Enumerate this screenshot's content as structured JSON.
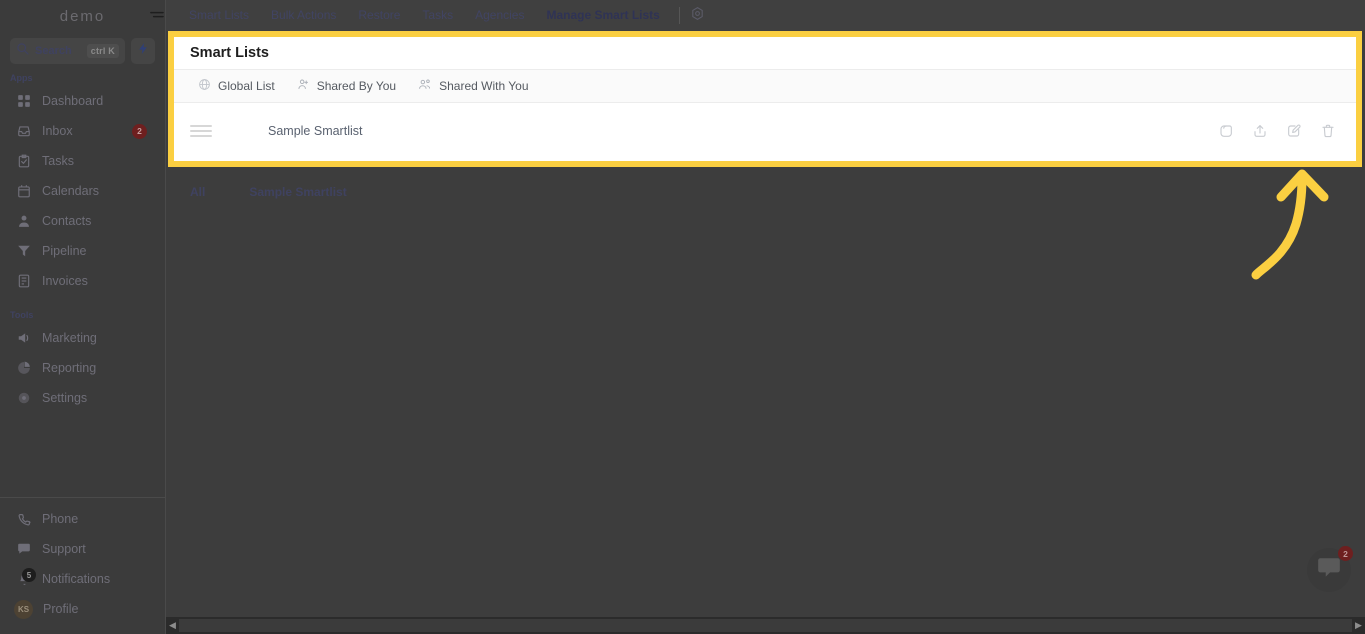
{
  "colors": {
    "highlight": "#FBCF41",
    "arrow": "#FBCF41",
    "panel_bg": "#ffffff",
    "app_bg": "#3d3d3d",
    "sidebar_bg": "#3b3b3b",
    "badge_red": "#6e1f1f",
    "nav_link": "#414463"
  },
  "sidebar": {
    "brand": "demo",
    "collapse_icon": "collapse-menu-icon",
    "search": {
      "label": "Search",
      "placeholder": "Search",
      "shortcut": "ctrl K"
    },
    "quick_action_icon": "lightning-bolt-icon",
    "sections": [
      {
        "label": "Apps",
        "items": [
          {
            "label": "Dashboard",
            "icon": "dashboard-grid-icon",
            "badge": ""
          },
          {
            "label": "Inbox",
            "icon": "inbox-icon",
            "badge": "2"
          },
          {
            "label": "Tasks",
            "icon": "tasks-clipboard-icon",
            "badge": ""
          },
          {
            "label": "Calendars",
            "icon": "calendar-icon",
            "badge": ""
          },
          {
            "label": "Contacts",
            "icon": "contacts-person-icon",
            "badge": ""
          },
          {
            "label": "Pipeline",
            "icon": "pipeline-funnel-icon",
            "badge": ""
          },
          {
            "label": "Invoices",
            "icon": "invoices-document-icon",
            "badge": ""
          }
        ]
      },
      {
        "label": "Tools",
        "items": [
          {
            "label": "Marketing",
            "icon": "megaphone-icon",
            "badge": ""
          },
          {
            "label": "Reporting",
            "icon": "pie-chart-icon",
            "badge": ""
          },
          {
            "label": "Settings",
            "icon": "gear-icon",
            "badge": ""
          }
        ]
      }
    ],
    "bottom_items": [
      {
        "label": "Phone",
        "icon": "phone-icon",
        "badge": ""
      },
      {
        "label": "Support",
        "icon": "support-chat-icon",
        "badge": ""
      },
      {
        "label": "Notifications",
        "icon": "bell-icon",
        "badge": "5"
      }
    ],
    "profile": {
      "label": "Profile",
      "initials": "KS"
    }
  },
  "topnav": {
    "items": [
      {
        "label": "Smart Lists",
        "active": false
      },
      {
        "label": "Bulk Actions",
        "active": false
      },
      {
        "label": "Restore",
        "active": false
      },
      {
        "label": "Tasks",
        "active": false
      },
      {
        "label": "Agencies",
        "active": false
      },
      {
        "label": "Manage Smart Lists",
        "active": true
      }
    ],
    "settings_icon": "gear-icon"
  },
  "panel": {
    "title": "Smart Lists",
    "filters": [
      {
        "label": "Global List",
        "icon": "globe-icon"
      },
      {
        "label": "Shared By You",
        "icon": "person-share-icon"
      },
      {
        "label": "Shared With You",
        "icon": "people-group-icon"
      }
    ],
    "rows": [
      {
        "name": "Sample Smartlist",
        "drag_handle": "drag-handle-icon",
        "actions": [
          {
            "name": "duplicate-icon",
            "glyph": "duplicate"
          },
          {
            "name": "share-upload-icon",
            "glyph": "upload"
          },
          {
            "name": "edit-icon",
            "glyph": "edit"
          },
          {
            "name": "delete-icon",
            "glyph": "trash"
          }
        ]
      }
    ]
  },
  "subtabs": [
    {
      "label": "All"
    },
    {
      "label": "Sample Smartlist"
    }
  ],
  "annotation": {
    "type": "curved-arrow-up",
    "points_to": "edit-icon",
    "color": "#FBCF41"
  },
  "chat_widget": {
    "icon": "chat-bubble-icon",
    "badge": "2"
  },
  "scrollbar": {
    "left_arrow": "◀",
    "right_arrow": "▶"
  }
}
